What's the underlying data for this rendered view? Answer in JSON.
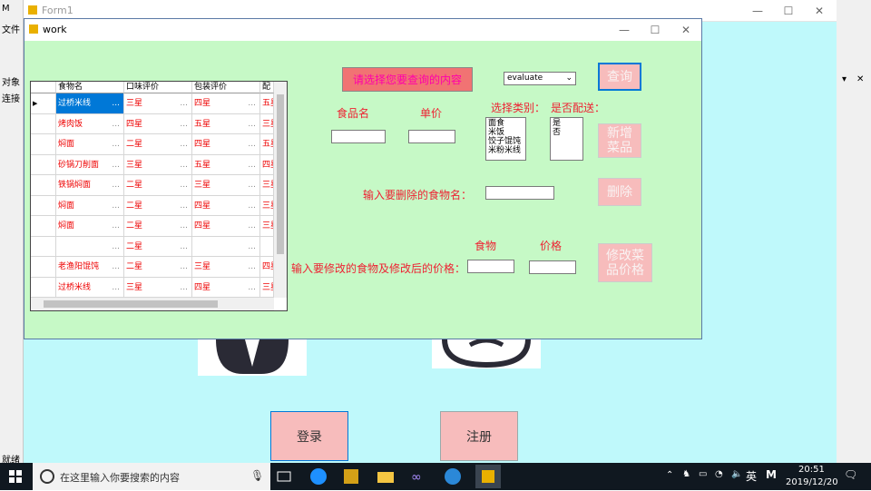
{
  "ide": {
    "title_fragment": "M",
    "menu_file": "文件",
    "object_tab": "对象",
    "connect": "连接",
    "status": "就绪"
  },
  "form1": {
    "title": "Form1",
    "login_label": "登录",
    "register_label": "注册"
  },
  "work": {
    "title": "work",
    "banner_label": "请选择您要查询的内容",
    "combo_value": "evaluate",
    "query_label": "查询",
    "food_name_label": "食品名",
    "price_label": "单价",
    "category_label": "选择类别：",
    "delivery_label": "是否配送：",
    "categories": [
      "面食",
      "米饭",
      "饺子馄饨",
      "米粉米线"
    ],
    "delivery_options": [
      "是",
      "否"
    ],
    "add_label": "新增\n菜品",
    "delete_prompt": "输入要删除的食物名：",
    "delete_label": "删除",
    "modify_prompt": "输入要修改的食物及修改后的价格：",
    "food_col": "食物",
    "price_col": "价格",
    "modify_label": "修改菜\n品价格"
  },
  "grid": {
    "headers": [
      "食物名",
      "口味评价",
      "包装评价",
      "配"
    ],
    "rows": [
      [
        "过桥米线",
        "三星",
        "四星",
        "五星"
      ],
      [
        "烤肉饭",
        "四星",
        "五星",
        "三星"
      ],
      [
        "焖面",
        "二星",
        "四星",
        "五星"
      ],
      [
        "砂锅刀削面",
        "三星",
        "五星",
        "四星"
      ],
      [
        "铁锅焖面",
        "二星",
        "三星",
        "三星"
      ],
      [
        "焖面",
        "二星",
        "四星",
        "三星"
      ],
      [
        "焖面",
        "二星",
        "四星",
        "三星"
      ],
      [
        "",
        "二星",
        "",
        ""
      ],
      [
        "老渔阳馄饨",
        "二星",
        "三星",
        "四星"
      ],
      [
        "过桥米线",
        "三星",
        "四星",
        "三星"
      ]
    ]
  },
  "taskbar": {
    "search_placeholder": "在这里输入你要搜索的内容",
    "ime": "英",
    "ime2": "M",
    "time": "20:51",
    "date": "2019/12/20"
  }
}
